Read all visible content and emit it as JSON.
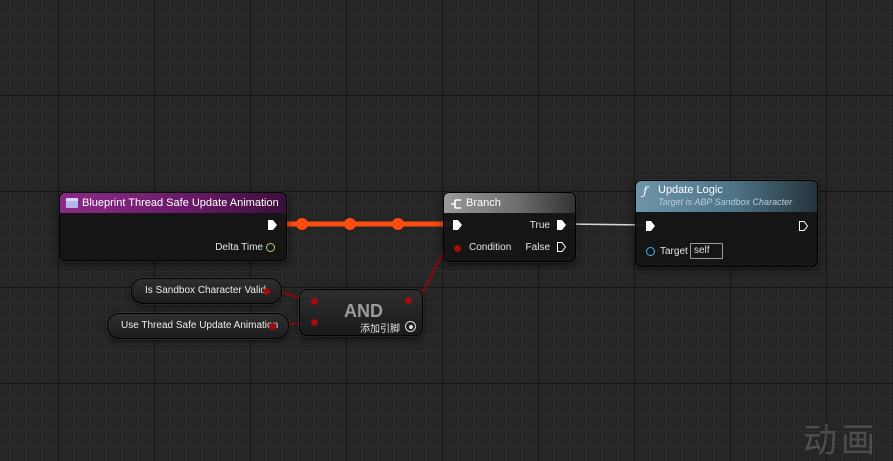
{
  "colors": {
    "grid_background": "#262626",
    "exec_wire": "#ff4a10",
    "exec_wire_white": "#d8d8d8",
    "bool_wire": "#8a0b0b",
    "event_header": "#7a1c78",
    "branch_header": "#8c8c8c",
    "function_header": "#5c8196"
  },
  "event_node": {
    "title": "Blueprint Thread Safe Update Animation",
    "icon": "event-icon",
    "output_label": "Delta Time"
  },
  "branch_node": {
    "title": "Branch",
    "icon": "branch-icon",
    "condition_label": "Condition",
    "true_label": "True",
    "false_label": "False"
  },
  "function_node": {
    "title": "Update Logic",
    "subtitle": "Target is ABP Sandbox Character",
    "icon": "function-icon",
    "target_label": "Target",
    "target_value": "self"
  },
  "and_node": {
    "title": "AND",
    "add_pin_label": "添加引脚",
    "add_pin_icon": "plus-circle-icon"
  },
  "variables": [
    {
      "label": "Is Sandbox Character Valid"
    },
    {
      "label": "Use Thread Safe Update Animation"
    }
  ],
  "watermark": "动画"
}
